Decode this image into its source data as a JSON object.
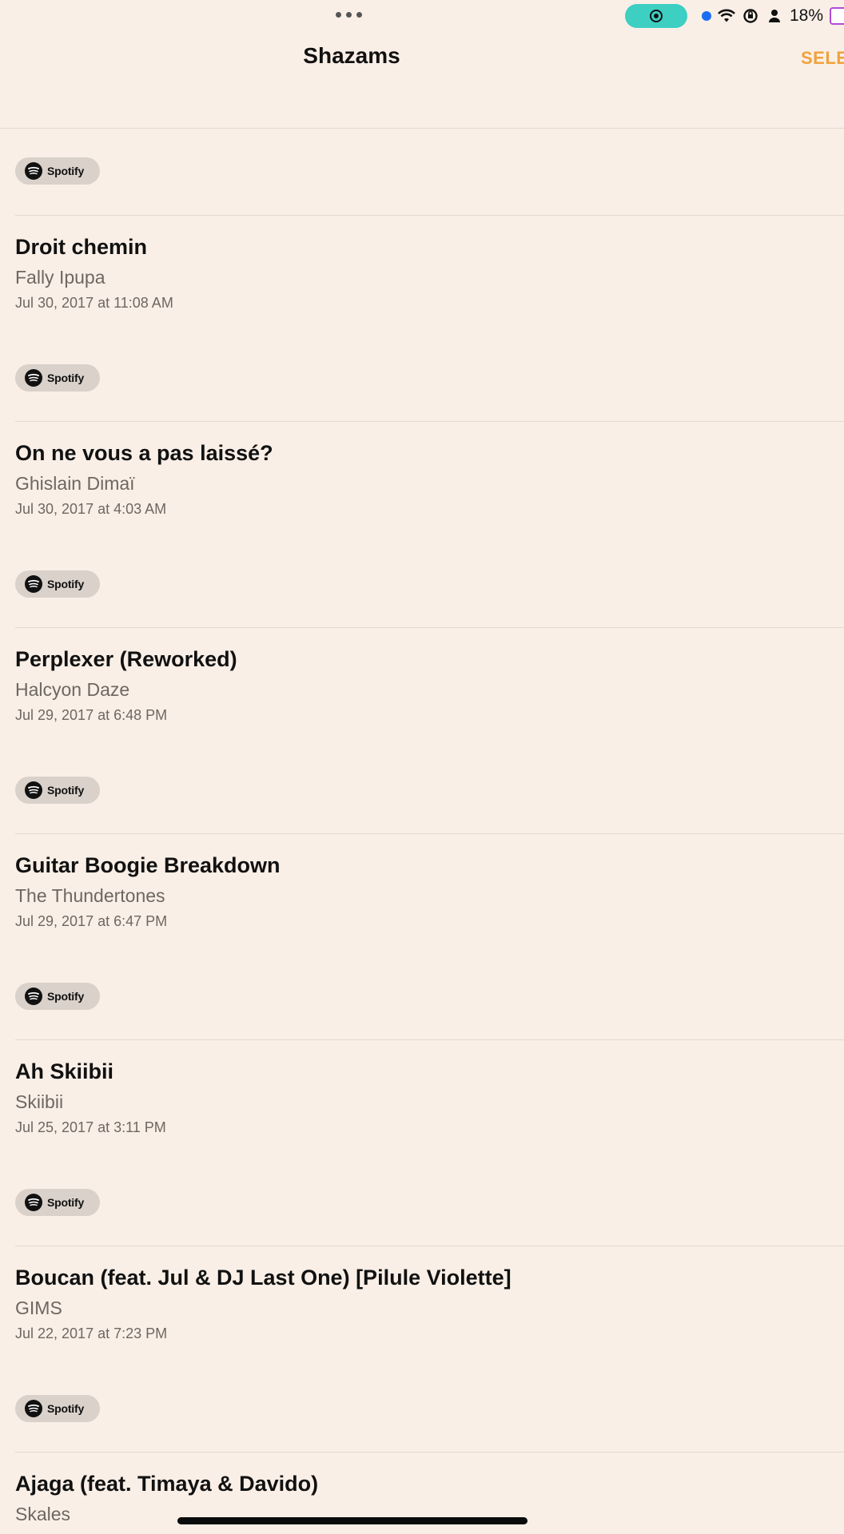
{
  "status_bar": {
    "battery": "18%",
    "colors": {
      "record_pill": "#3CCFC2",
      "location_dot": "#1B6EF3",
      "battery_outline": "#B24BD8"
    }
  },
  "nav": {
    "title": "Shazams",
    "select_label": "SELECT",
    "select_color": "#F0A23B"
  },
  "spotify_label": "Spotify",
  "songs": [
    {
      "title": "Droit chemin",
      "artist": "Fally Ipupa",
      "date": "Jul 30, 2017 at 11:08 AM"
    },
    {
      "title": "On ne vous a pas laissé?",
      "artist": "Ghislain Dimaï",
      "date": "Jul 30, 2017 at 4:03 AM"
    },
    {
      "title": "Perplexer (Reworked)",
      "artist": "Halcyon Daze",
      "date": "Jul 29, 2017 at 6:48 PM"
    },
    {
      "title": "Guitar Boogie Breakdown",
      "artist": "The Thundertones",
      "date": "Jul 29, 2017 at 6:47 PM"
    },
    {
      "title": "Ah Skiibii",
      "artist": "Skiibii",
      "date": "Jul 25, 2017 at 3:11 PM"
    },
    {
      "title": "Boucan (feat. Jul & DJ Last One) [Pilule Violette]",
      "artist": "GIMS",
      "date": "Jul 22, 2017 at 7:23 PM"
    },
    {
      "title": "Ajaga (feat. Timaya & Davido)",
      "artist": "Skales"
    }
  ]
}
